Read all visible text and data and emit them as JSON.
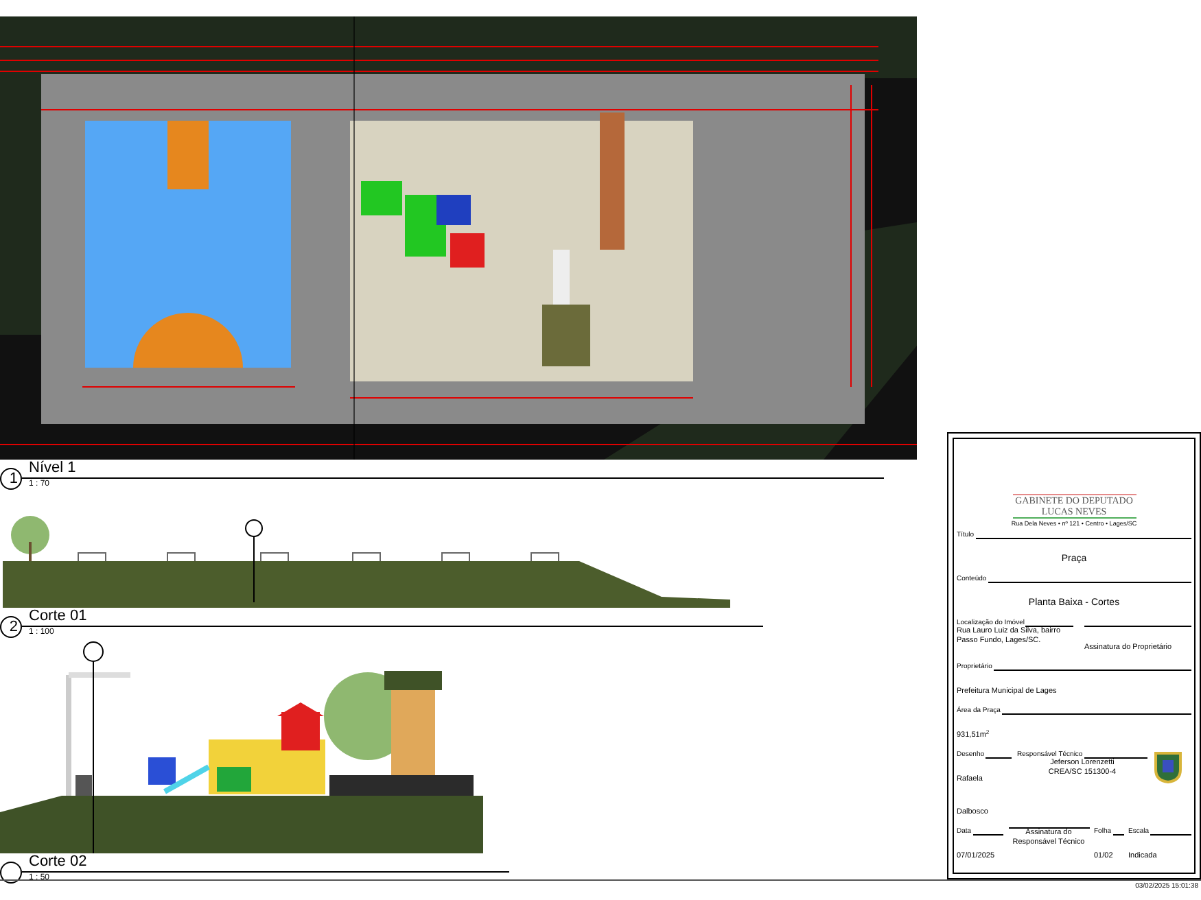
{
  "views": [
    {
      "kind": "plan",
      "number": "1",
      "title": "Nível 1",
      "scale": "1 : 70"
    },
    {
      "kind": "section_long",
      "number": "2",
      "title": "Corte 01",
      "scale": "1 : 100"
    },
    {
      "kind": "section_short",
      "title": "Corte 02",
      "scale": "1 : 50"
    }
  ],
  "title_block": {
    "office": "GABINETE DO DEPUTADO",
    "name": "LUCAS NEVES",
    "address": "Rua Dela Neves • nº 121 • Centro • Lages/SC",
    "title_label": "Título",
    "title": "Praça",
    "content_label": "Conteúdo",
    "content": "Planta Baixa - Cortes",
    "location_label": "Localização do Imóvel",
    "location": "Rua Lauro Luiz da Silva, bairro Passo Fundo, Lages/SC.",
    "owner_signature": "Assinatura do Proprietário",
    "owner_label": "Proprietário",
    "owner": "Prefeitura Municipal de Lages",
    "area_label": "Área da Praça",
    "area": "931,51m$^{2}$",
    "drawing_label": "Desenho",
    "drawer": "Rafaela Dalbosco",
    "tech_label": "Responsável Técnico",
    "tech": "Jeferson Lorenzetti",
    "tech_reg": "CREA/SC 151300-4",
    "date_label": "Data",
    "date": "07/01/2025",
    "tech_signature": "Assinatura do Responsável Técnico",
    "sheet_label": "Folha",
    "sheet": "01/02",
    "scale_label": "Escala",
    "scale": "Indicada"
  },
  "timestamp": "03/02/2025 15:01:38"
}
